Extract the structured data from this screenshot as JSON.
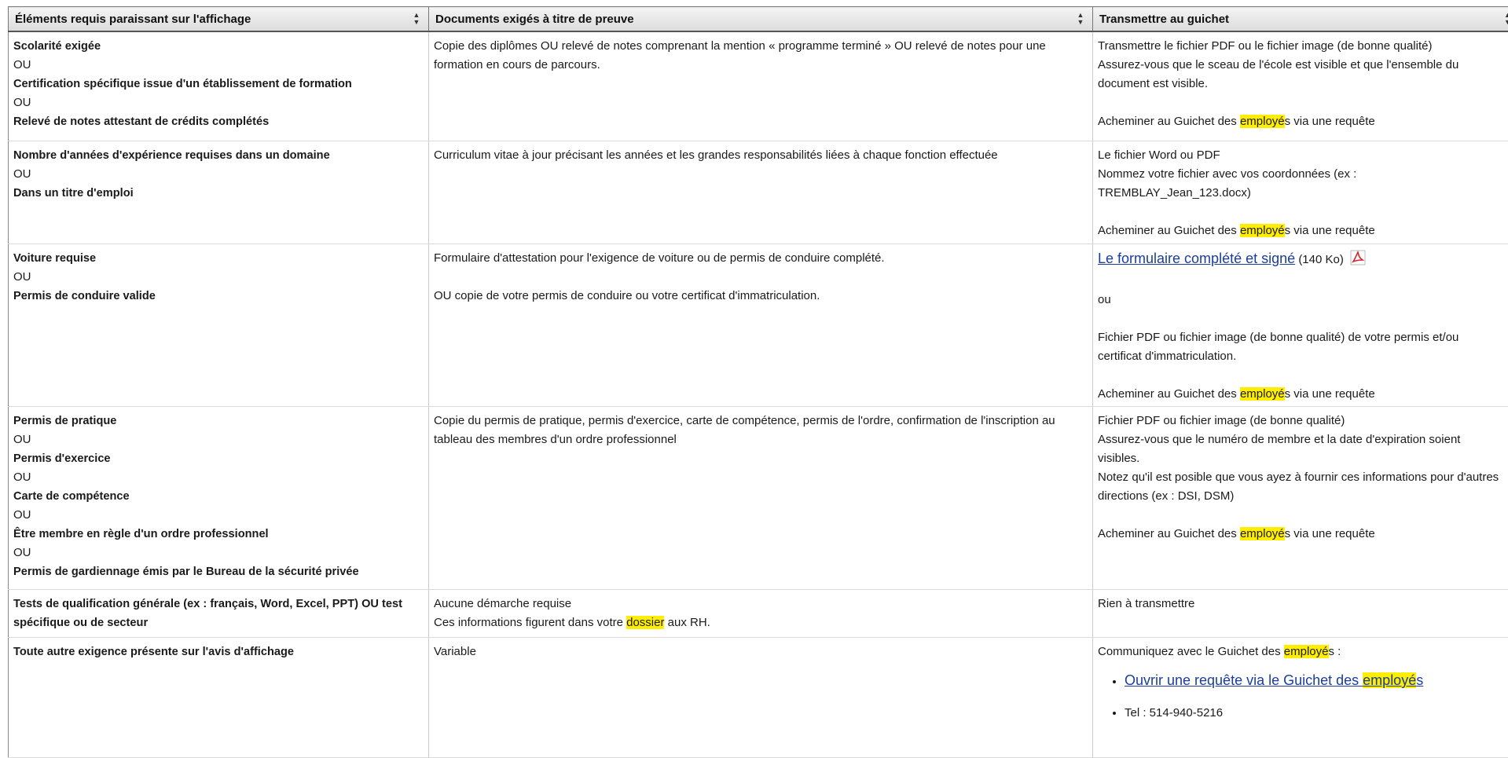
{
  "header": {
    "col1": "Éléments requis paraissant sur l'affichage",
    "col2": "Documents exigés à titre de preuve",
    "col3": "Transmettre au guichet"
  },
  "common": {
    "ou": "OU",
    "acheminer_pre": "Acheminer au Guichet des ",
    "employes_hl": "employé",
    "acheminer_post": "s via une requête"
  },
  "rows": [
    {
      "req": [
        "Scolarité exigée",
        "OU",
        "Certification spécifique issue d'un établissement de formation",
        "OU",
        "Relevé de notes attestant de crédits complétés"
      ],
      "doc": "Copie des diplômes OU relevé de notes comprenant la mention « programme terminé » OU relevé de notes pour une formation en cours de parcours.",
      "send": [
        "Transmettre le fichier PDF ou le fichier image (de bonne qualité)",
        "Assurez-vous que le sceau de l'école est visible et que l'ensemble du document est visible."
      ]
    },
    {
      "req": [
        "Nombre d'années d'expérience requises dans un domaine",
        "OU",
        "Dans un titre d'emploi"
      ],
      "doc": "Curriculum vitae à jour précisant les années et les grandes responsabilités liées à chaque fonction effectuée",
      "send": [
        "Le fichier Word ou PDF",
        "Nommez votre fichier avec vos coordonnées (ex : TREMBLAY_Jean_123.docx)"
      ]
    },
    {
      "req": [
        "Voiture requise",
        "OU",
        "Permis de conduire valide"
      ],
      "doc": "Formulaire d'attestation pour l'exigence de voiture ou de permis de conduire complété.",
      "doc2": "OU copie de votre permis de conduire ou votre certificat d'immatriculation.",
      "link": "Le formulaire complété et signé",
      "size": "(140 Ko)",
      "or": "ou",
      "send": "Fichier PDF ou fichier image (de bonne qualité) de votre permis et/ou certificat d'immatriculation."
    },
    {
      "req": [
        "Permis de pratique",
        "OU",
        "Permis d'exercice",
        "OU",
        "Carte de compétence",
        "OU",
        "Être membre en règle d'un ordre professionnel",
        "OU",
        "Permis de gardiennage émis par le Bureau de la sécurité privée"
      ],
      "doc": "Copie du permis de pratique, permis d'exercice, carte de compétence, permis de l'ordre, confirmation de l'inscription au tableau des membres d'un ordre professionnel",
      "send": [
        "Fichier PDF ou fichier image (de bonne qualité)",
        "Assurez-vous que le numéro de membre et la date d'expiration soient visibles.",
        "Notez qu'il est posible que vous ayez à fournir ces informations pour d'autres directions (ex : DSI, DSM)"
      ]
    },
    {
      "req": "Tests de qualification générale (ex : français, Word, Excel, PPT) OU test spécifique ou de secteur",
      "doc1": "Aucune démarche requise",
      "doc2_pre": "Ces informations figurent dans votre ",
      "doc2_hl": "dossier",
      "doc2_post": " aux RH.",
      "send": "Rien à transmettre"
    },
    {
      "req": "Toute autre exigence présente sur l'avis d'affichage",
      "doc": "Variable",
      "send_pre": "Communiquez avec le Guichet des ",
      "send_post": "s :",
      "link_pre": "Ouvrir une requête via le Guichet des ",
      "link_hl": "employé",
      "link_post": "s",
      "tel": "Tel : 514-940-5216"
    }
  ]
}
